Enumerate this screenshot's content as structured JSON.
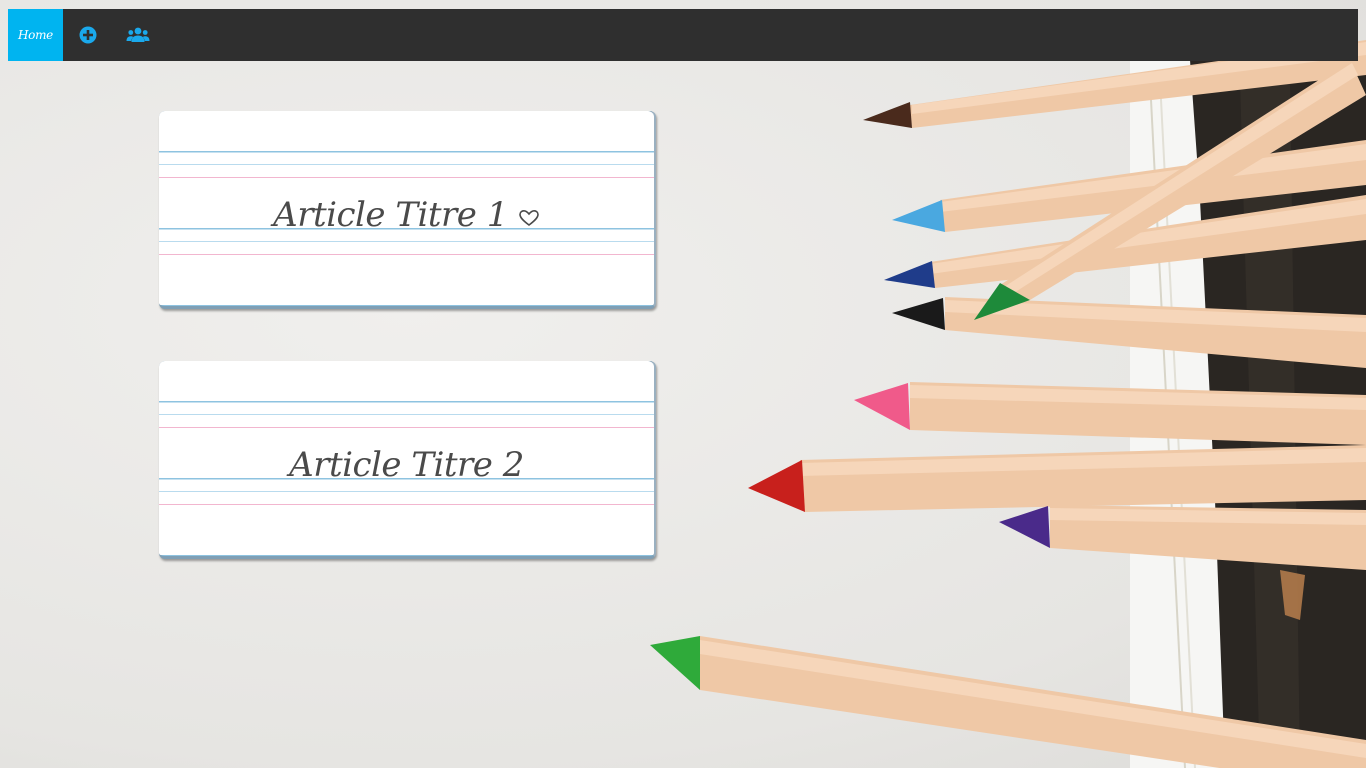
{
  "nav": {
    "home_label": "Home",
    "add_icon": "plus-circle-icon",
    "users_icon": "users-icon",
    "active_color": "#00b4f0",
    "bar_color": "#2f2f2f"
  },
  "articles": [
    {
      "title": "Article Titre 1",
      "icon": "heart-outline-icon"
    },
    {
      "title": "Article Titre 2"
    }
  ]
}
